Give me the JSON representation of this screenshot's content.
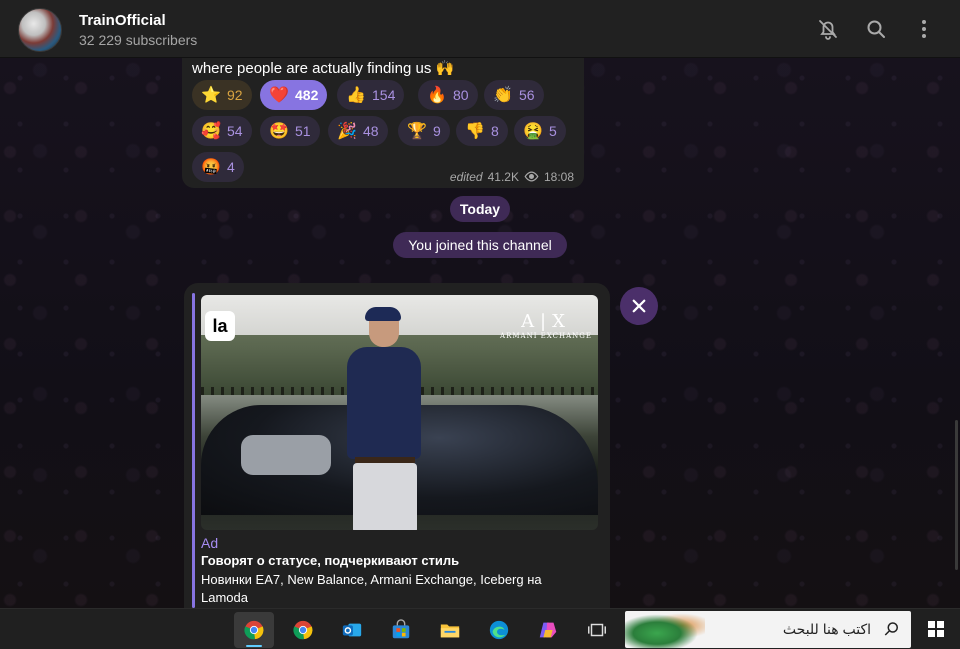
{
  "header": {
    "title": "TrainOfficial",
    "subtitle": "32 229 subscribers",
    "icons": [
      "bell-off-icon",
      "search-icon",
      "more-vert-icon"
    ]
  },
  "message": {
    "text": "where people are actually finding us 🙌",
    "reactions": [
      {
        "emoji": "⭐",
        "count": "92",
        "style": "gold"
      },
      {
        "emoji": "❤️",
        "count": "482",
        "style": "active"
      },
      {
        "emoji": "👍",
        "count": "154"
      },
      {
        "emoji": "🔥",
        "count": "80"
      },
      {
        "emoji": "👏",
        "count": "56"
      },
      {
        "emoji": "🥰",
        "count": "54"
      },
      {
        "emoji": "🤩",
        "count": "51"
      },
      {
        "emoji": "🎉",
        "count": "48"
      },
      {
        "emoji": "🏆",
        "count": "9"
      },
      {
        "emoji": "👎",
        "count": "8"
      },
      {
        "emoji": "🤮",
        "count": "5"
      },
      {
        "emoji": "🤬",
        "count": "4"
      }
    ],
    "edited_label": "edited",
    "views": "41.2K",
    "time": "18:08"
  },
  "service": {
    "today": "Today",
    "joined": "You joined this channel"
  },
  "ad": {
    "logo_left": "la",
    "logo_right_mark": "A|X",
    "logo_right_brand": "ARMANI EXCHANGE",
    "label": "Ad",
    "title": "Говорят о статусе, подчеркивают стиль",
    "text": "Новинки EA7, New Balance, Armani Exchange, Iceberg на Lamoda"
  },
  "taskbar": {
    "apps": [
      "chrome-icon",
      "chrome-icon",
      "outlook-icon",
      "store-icon",
      "file-explorer-icon",
      "edge-icon",
      "copilot-icon",
      "task-view-icon"
    ],
    "search_placeholder": "اكتب هنا للبحث"
  },
  "colors": {
    "accent": "#8774e1",
    "pill_bg": "#3f2a56",
    "bubble_bg": "#212121"
  }
}
